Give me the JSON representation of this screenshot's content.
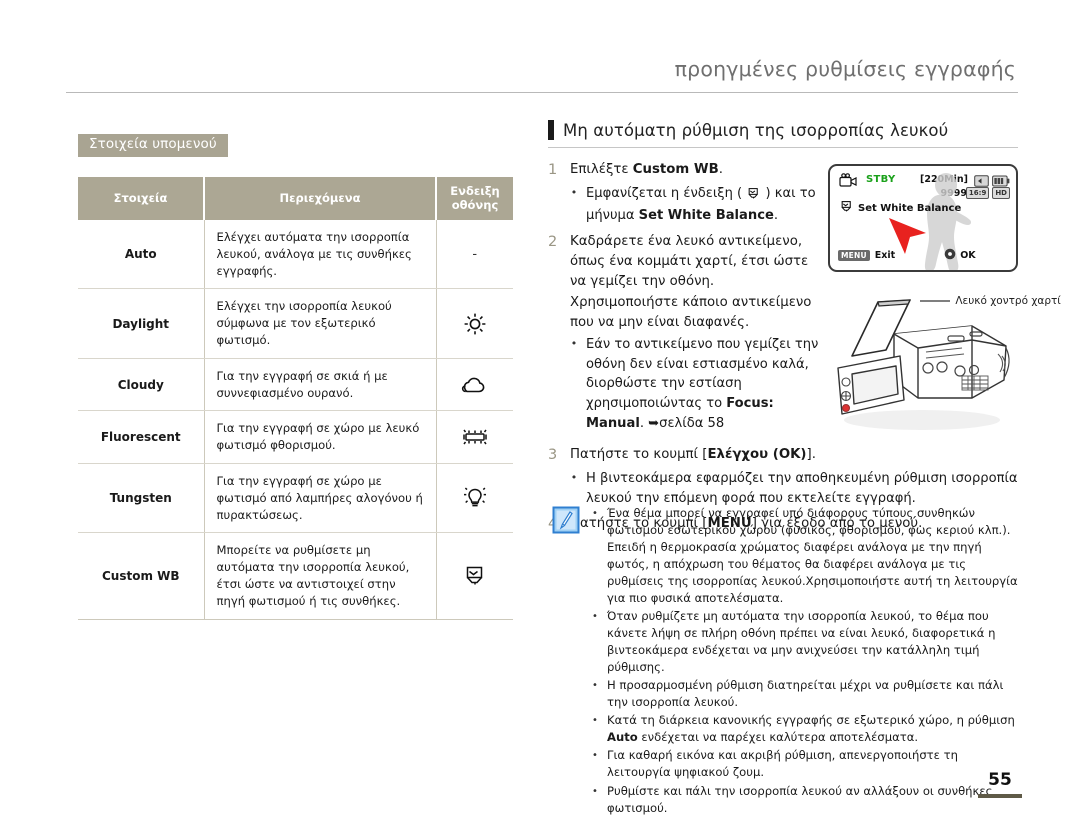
{
  "header": {
    "title": "προηγμένες ρυθμίσεις εγγραφής"
  },
  "left": {
    "subsection_label": "Στοιχεία υπομενού",
    "table": {
      "columns": [
        "Στοιχεία",
        "Περιεχόμενα",
        "Ενδειξη οθόνης"
      ],
      "col_indicator_line1": "Ενδειξη",
      "col_indicator_line2": "οθόνης",
      "rows": [
        {
          "name": "Auto",
          "desc": "Ελέγχει αυτόματα την ισορροπία λευκού, ανάλογα με τις συνθήκες εγγραφής.",
          "indicator": "-",
          "icon": "none"
        },
        {
          "name": "Daylight",
          "desc": "Ελέγχει την ισορροπία λευκού σύμφωνα με τον εξωτερικό φωτισμό.",
          "indicator": "",
          "icon": "sun-icon"
        },
        {
          "name": "Cloudy",
          "desc": "Για την εγγραφή σε σκιά ή με συννεφιασμένο ουρανό.",
          "indicator": "",
          "icon": "cloud-icon"
        },
        {
          "name": "Fluorescent",
          "desc": "Για την εγγραφή σε χώρο με λευκό φωτισμό φθορισμού.",
          "indicator": "",
          "icon": "fluorescent-lamp-icon"
        },
        {
          "name": "Tungsten",
          "desc": "Για την εγγραφή σε χώρο με φωτισμό από λαμπήρες αλογόνου ή πυρακτώσεως.",
          "indicator": "",
          "icon": "tungsten-bulb-icon"
        },
        {
          "name": "Custom WB",
          "desc": "Μπορείτε να ρυθμίσετε μη αυτόματα την ισορροπία λευκού, έτσι ώστε να αντιστοιχεί στην πηγή φωτισμού ή τις συνθήκες.",
          "indicator": "",
          "icon": "custom-wb-icon"
        }
      ]
    }
  },
  "right": {
    "section_title": "Μη αυτόματη ρύθμιση της ισορροπίας λευκού",
    "steps": [
      {
        "num": "1",
        "text_before": "Επιλέξτε ",
        "bold": "Custom WB",
        "text_after": ".",
        "bullets": [
          {
            "pre": "Εμφανίζεται η ένδειξη ( ",
            "icon": "custom-wb-icon",
            "mid": " ) και το μήνυμα ",
            "bold": "Set White Balance",
            "post": "."
          }
        ]
      },
      {
        "num": "2",
        "text_before": "Καδράρετε ένα λευκό αντικείμενο, όπως ένα κομμάτι χαρτί, έτσι ώστε να γεμίζει την οθόνη. Χρησιμοποιήστε κάποιο αντικείμενο που να μην είναι διαφανές.",
        "bold": "",
        "text_after": "",
        "bullets": [
          {
            "pre": "Εάν το αντικείμενο που γεμίζει την οθόνη δεν είναι εστιασμένο καλά, διορθώστε την εστίαση χρησιμοποιώντας το ",
            "icon": "",
            "mid": "",
            "bold": "Focus: Manual",
            "post": ". ➥σελίδα 58"
          }
        ]
      },
      {
        "num": "3",
        "text_before": "Πατήστε το κουμπί [",
        "bold": "Ελέγχου (OK)",
        "text_after": "].",
        "bullets": [
          {
            "pre": "Η βιντεοκάμερα εφαρμόζει την αποθηκευμένη ρύθμιση ισορροπία λευκού την επόμενη φορά που εκτελείτε εγγραφή.",
            "icon": "",
            "mid": "",
            "bold": "",
            "post": ""
          }
        ]
      },
      {
        "num": "4",
        "text_before": "Πατήστε το κουμπί [",
        "bold": "MENU",
        "text_after": "] για έξοδο από το μενού.",
        "bullets": []
      }
    ]
  },
  "lcd": {
    "status": "STBY",
    "record_time": "[220Min]",
    "photo_count": "9999",
    "message": "Set White Balance",
    "menu_chip": "MENU",
    "exit_label": "Exit",
    "ok_label": "OK",
    "badge_quality": "16:9",
    "badge_hd": "HD",
    "status_color": "#1aa11a"
  },
  "camcorder": {
    "paper_label": "Λευκό χοντρό χαρτί"
  },
  "notes": {
    "icon": "note-pen-icon",
    "items": [
      "Ένα θέμα μπορεί να εγγραφεί υπό διάφορους τύπους συνθηκών φωτισμού εσωτερικού χώρου (φυσικός, φθορισμού, φως κεριού κλπ.). Επειδή η θερμοκρασία χρώματος διαφέρει ανάλογα με την πηγή φωτός, η απόχρωση του θέματος θα διαφέρει ανάλογα με τις ρυθμίσεις της ισορροπίας λευκού.Χρησιμοποιήστε αυτή τη λειτουργία για πιο φυσικά αποτελέσματα.",
      "Όταν ρυθμίζετε μη αυτόματα την ισορροπία λευκού, το θέμα που κάνετε λήψη σε πλήρη οθόνη πρέπει να είναι λευκό, διαφορετικά η βιντεοκάμερα ενδέχεται να μην ανιχνεύσει την κατάλληλη τιμή ρύθμισης.",
      "Η προσαρμοσμένη ρύθμιση διατηρείται μέχρι να ρυθμίσετε και πάλι την ισορροπία λευκού.",
      "Κατά τη διάρκεια κανονικής εγγραφής σε εξωτερικό χώρο, η ρύθμιση <b>Auto</b> ενδέχεται να παρέχει καλύτερα αποτελέσματα.",
      "Για καθαρή εικόνα και ακριβή ρύθμιση, απενεργοποιήστε τη λειτουργία ψηφιακού ζουμ.",
      "Ρυθμίστε και πάλι την ισορροπία λευκού αν αλλάξουν οι συνθήκες φωτισμού."
    ]
  },
  "footer": {
    "page_number": "55"
  },
  "colors": {
    "chip_bg": "#a9a492",
    "table_header_bg": "#aca794",
    "accent_bar": "#5f5a47",
    "step_number": "#9a9685",
    "note_icon_bg": "#3f8fdc"
  }
}
